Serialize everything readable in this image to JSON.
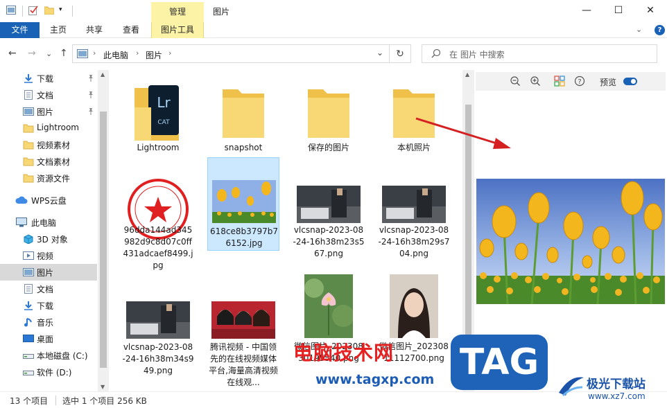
{
  "window": {
    "title": "图片",
    "context_tab": "管理",
    "controls": {
      "minimize": "—",
      "maximize": "☐",
      "close": "✕"
    }
  },
  "ribbon": {
    "tabs": [
      "文件",
      "主页",
      "共享",
      "查看",
      "图片工具"
    ],
    "expand": "⌄",
    "help": "?"
  },
  "address": {
    "crumbs": [
      "此电脑",
      "图片"
    ],
    "separator": "›",
    "dropdown": "⌄",
    "refresh": "↻",
    "search_placeholder": "在 图片 中搜索"
  },
  "nav": {
    "back": "←",
    "forward": "→",
    "recent": "⌄",
    "up": "↑"
  },
  "sidebar": {
    "items": [
      {
        "label": "下载",
        "icon": "download-arrow-icon",
        "pinned": true
      },
      {
        "label": "文档",
        "icon": "document-icon",
        "pinned": true
      },
      {
        "label": "图片",
        "icon": "pictures-icon",
        "pinned": true
      },
      {
        "label": "Lightroom",
        "icon": "folder-icon",
        "pinned": false
      },
      {
        "label": "视频素材",
        "icon": "folder-icon",
        "pinned": false
      },
      {
        "label": "文档素材",
        "icon": "folder-icon",
        "pinned": false
      },
      {
        "label": "资源文件",
        "icon": "folder-icon",
        "pinned": false
      },
      {
        "label": "WPS云盘",
        "icon": "cloud-icon",
        "pinned": false
      },
      {
        "label": "此电脑",
        "icon": "computer-icon",
        "pinned": false
      },
      {
        "label": "3D 对象",
        "icon": "cube-3d-icon",
        "pinned": false
      },
      {
        "label": "视频",
        "icon": "video-icon",
        "pinned": false
      },
      {
        "label": "图片",
        "icon": "pictures-icon",
        "pinned": false,
        "selected": true
      },
      {
        "label": "文档",
        "icon": "document-icon",
        "pinned": false
      },
      {
        "label": "下载",
        "icon": "download-arrow-icon",
        "pinned": false
      },
      {
        "label": "音乐",
        "icon": "music-icon",
        "pinned": false
      },
      {
        "label": "桌面",
        "icon": "desktop-icon",
        "pinned": false
      },
      {
        "label": "本地磁盘 (C:)",
        "icon": "drive-icon",
        "pinned": false
      },
      {
        "label": "软件 (D:)",
        "icon": "drive-icon",
        "pinned": false
      }
    ],
    "pin_glyph": "📌"
  },
  "files": [
    {
      "name": "Lightroom",
      "kind": "folder-lightroom"
    },
    {
      "name": "snapshot",
      "kind": "folder"
    },
    {
      "name": "保存的图片",
      "kind": "folder"
    },
    {
      "name": "本机照片",
      "kind": "folder"
    },
    {
      "name": "96dda144ad345982d9c8d07c0ff431adcaef8499.jpg",
      "kind": "stamp"
    },
    {
      "name": "618ce8b3797b76152.jpg",
      "kind": "tulips",
      "selected": true
    },
    {
      "name": "vlcsnap-2023-08-24-16h38m23s567.png",
      "kind": "bedroom"
    },
    {
      "name": "vlcsnap-2023-08-24-16h38m29s704.png",
      "kind": "bedroom"
    },
    {
      "name": "vlcsnap-2023-08-24-16h38m34s949.png",
      "kind": "bedroom"
    },
    {
      "name": "腾讯视频 - 中国领先的在线视频媒体平台,海量高清视频在线观...",
      "kind": "people"
    },
    {
      "name": "微信图片_20230830195540.png",
      "kind": "lotus"
    },
    {
      "name": "微信图片_20230811112700.png",
      "kind": "portrait"
    }
  ],
  "preview": {
    "zoom_out": "−",
    "zoom_in": "+",
    "help": "?",
    "toggle_label": "预览"
  },
  "status": {
    "count": "13 个项目",
    "selection": "选中 1 个项目  256 KB"
  },
  "watermark": {
    "site": "电脑技术网",
    "url": "www.tagxp.com",
    "tag": "TAG",
    "logo_text": "极光下载站",
    "logo_url": "www.xz7.com"
  },
  "colors": {
    "accent": "#1a62b6",
    "context_tab": "#fdf3a6",
    "selection": "#cce8ff",
    "folder": "#f8d775",
    "arrow": "#d42020"
  }
}
